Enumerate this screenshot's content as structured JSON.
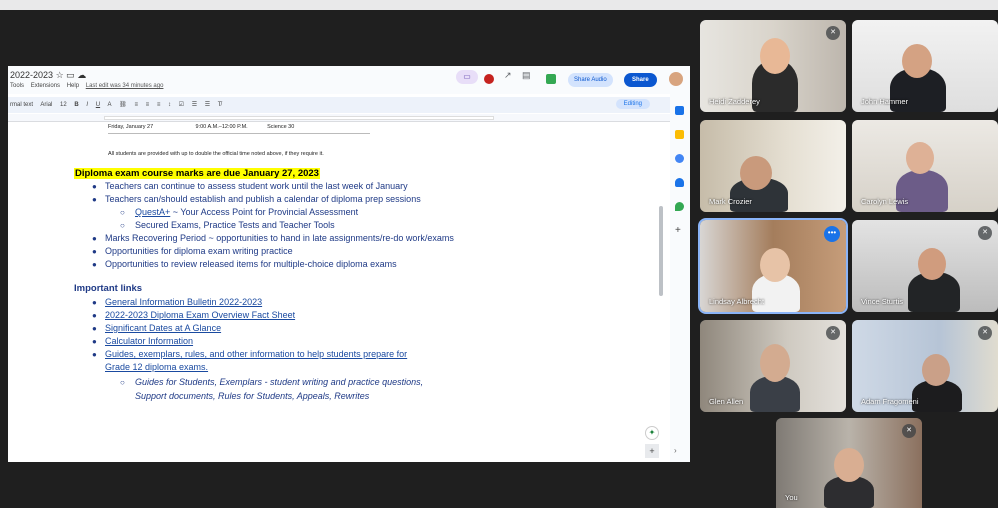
{
  "doc": {
    "title": "2022-2023",
    "menus": [
      "Tools",
      "Extensions",
      "Help"
    ],
    "last_edit": "Last edit was 34 minutes ago",
    "toolbar": {
      "style": "rmal text",
      "font": "Arial",
      "size": "12",
      "bold": "B",
      "italic": "I",
      "underline": "U",
      "text_color": "A",
      "editing": "Editing"
    },
    "share_audio": "Share Audio",
    "share": "Share",
    "schedule_row": {
      "date": "Friday, January 27",
      "time": "9:00 A.M.–12:00 P.M.",
      "subject": "Science 30"
    },
    "note": "All students are provided with up to double the official time noted above, if they require it.",
    "highlight": "Diploma exam course marks are due January 27, 2023",
    "bullets": [
      {
        "text": "Teachers can continue to assess student work until the last week of January",
        "level": 1
      },
      {
        "text": "Teachers can/should establish and publish a calendar of diploma prep sessions",
        "level": 1
      },
      {
        "link": "QuestA+",
        "text": " ~ Your Access Point for Provincial Assessment",
        "level": 2
      },
      {
        "text": "Secured Exams, Practice Tests and Teacher Tools",
        "level": 2
      },
      {
        "text": "Marks Recovering Period ~ opportunities to hand in late assignments/re-do work/exams",
        "level": 1
      },
      {
        "text": "Opportunities for diploma exam writing practice",
        "level": 1
      },
      {
        "text": "Opportunities to review released items for multiple-choice diploma exams",
        "level": 1
      }
    ],
    "links_heading": "Important links",
    "links": [
      "General Information Bulletin 2022-2023",
      "2022-2023 Diploma Exam Overview Fact Sheet",
      "Significant Dates at A Glance",
      "Calculator Information",
      "Guides, exemplars, rules, and other information to help students prepare for",
      "Grade 12 diploma exams."
    ],
    "sub_italic": [
      "Guides for Students, Exemplars - student writing and practice questions,",
      "Support documents, Rules for Students, Appeals, Rewrites"
    ]
  },
  "participants": [
    {
      "name": "Heidi Zadderey",
      "muted": true
    },
    {
      "name": "John Hammer",
      "muted": false
    },
    {
      "name": "Mark Crozier",
      "muted": false
    },
    {
      "name": "Carolyn Lewis",
      "muted": false
    },
    {
      "name": "Lindsay Albrecht",
      "muted": false
    },
    {
      "name": "Vince Sturtis",
      "muted": true
    },
    {
      "name": "Glen Allen",
      "muted": true
    },
    {
      "name": "Adam Fragomeni",
      "muted": true
    },
    {
      "name": "You",
      "muted": true
    }
  ]
}
